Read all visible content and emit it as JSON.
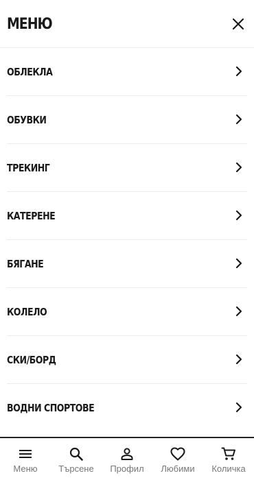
{
  "header": {
    "title": "МЕНЮ",
    "close_icon": "close-icon"
  },
  "menu": {
    "items": [
      {
        "label": "ОБЛЕКЛА",
        "icon": "chevron-right-icon"
      },
      {
        "label": "ОБУВКИ",
        "icon": "chevron-right-icon"
      },
      {
        "label": "ТРЕКИНГ",
        "icon": "chevron-right-icon"
      },
      {
        "label": "КАТЕРЕНЕ",
        "icon": "chevron-right-icon"
      },
      {
        "label": "БЯГАНЕ",
        "icon": "chevron-right-icon"
      },
      {
        "label": "КОЛЕЛО",
        "icon": "chevron-right-icon"
      },
      {
        "label": "СКИ/БОРД",
        "icon": "chevron-right-icon"
      },
      {
        "label": "ВОДНИ СПОРТОВЕ",
        "icon": "chevron-right-icon"
      }
    ]
  },
  "bottom_nav": {
    "items": [
      {
        "label": "Меню",
        "icon": "hamburger-menu-icon"
      },
      {
        "label": "Търсене",
        "icon": "search-icon"
      },
      {
        "label": "Профил",
        "icon": "user-icon"
      },
      {
        "label": "Любими",
        "icon": "heart-icon"
      },
      {
        "label": "Количка",
        "icon": "cart-icon"
      }
    ]
  },
  "colors": {
    "text": "#1a1a1a",
    "divider": "#ececec",
    "nav_label": "#777777",
    "nav_border": "#222222",
    "background": "#ffffff"
  }
}
